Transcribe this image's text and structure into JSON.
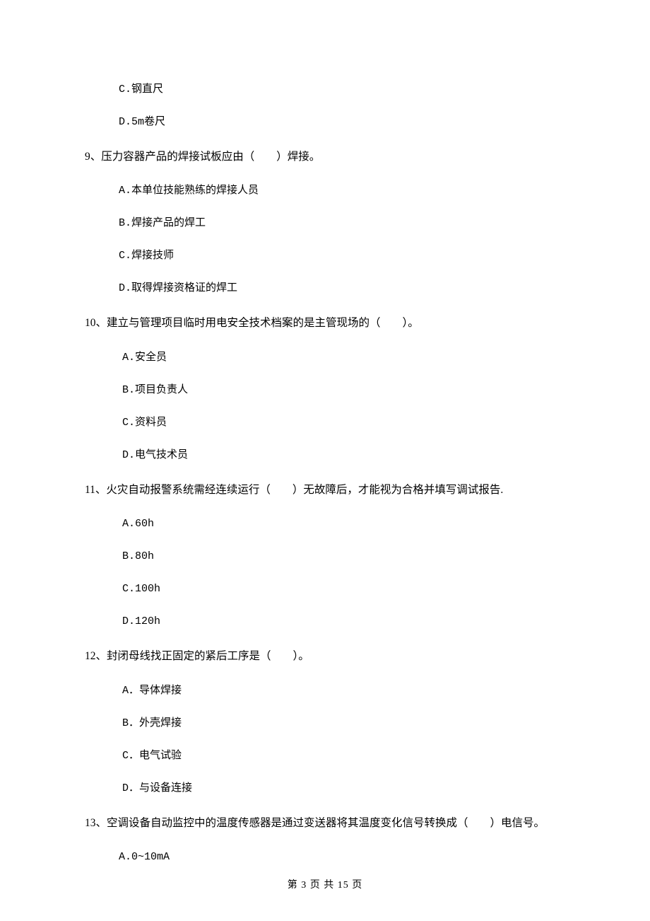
{
  "leading_options": [
    "C.钢直尺",
    "D.5m卷尺"
  ],
  "questions": [
    {
      "stem": "9、压力容器产品的焊接试板应由（　　）焊接。",
      "options": [
        "A.本单位技能熟练的焊接人员",
        "B.焊接产品的焊工",
        "C.焊接技师",
        "D.取得焊接资格证的焊工"
      ]
    },
    {
      "stem": "10、建立与管理项目临时用电安全技术档案的是主管现场的（　　）。",
      "options": [
        "A.安全员",
        "B.项目负责人",
        "C.资料员",
        "D.电气技术员"
      ]
    },
    {
      "stem": "11、火灾自动报警系统需经连续运行（　　）无故障后，才能视为合格并填写调试报告.",
      "options": [
        "A.60h",
        "B.80h",
        "C.100h",
        "D.120h"
      ]
    },
    {
      "stem": "12、封闭母线找正固定的紧后工序是（　　）。",
      "options": [
        "A．导体焊接",
        "B．外壳焊接",
        "C．电气试验",
        "D．与设备连接"
      ]
    },
    {
      "stem": "13、空调设备自动监控中的温度传感器是通过变送器将其温度变化信号转换成（　　）电信号。",
      "options": [
        "A.0~10mA"
      ]
    }
  ],
  "footer": "第 3 页 共 15 页"
}
